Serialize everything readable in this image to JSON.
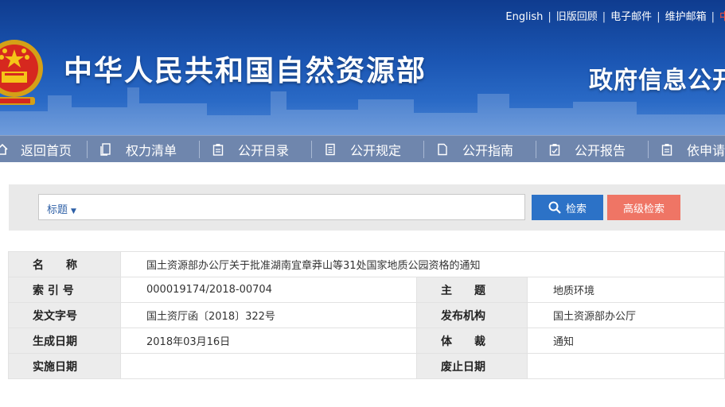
{
  "header": {
    "top_links": [
      "English",
      "旧版回顾",
      "电子邮件",
      "维护邮箱"
    ],
    "top_links_overflow": "中",
    "site_title": "中华人民共和国自然资源部",
    "section_title": "政府信息公开"
  },
  "nav": {
    "items": [
      {
        "label": "返回首页",
        "icon": "home-icon"
      },
      {
        "label": "权力清单",
        "icon": "list-icon"
      },
      {
        "label": "公开目录",
        "icon": "clipboard-icon"
      },
      {
        "label": "公开规定",
        "icon": "document-icon"
      },
      {
        "label": "公开指南",
        "icon": "page-icon"
      },
      {
        "label": "公开报告",
        "icon": "report-icon"
      },
      {
        "label": "依申请",
        "icon": "clipboard-icon"
      }
    ]
  },
  "search": {
    "scope_label": "标题",
    "input_value": "",
    "search_button": "检索",
    "advanced_button": "高级检索"
  },
  "info": {
    "name_label": "名　　称",
    "name_value": "国土资源部办公厅关于批准湖南宜章莽山等31处国家地质公园资格的通知",
    "index_label": "索 引 号",
    "index_value": "000019174/2018-00704",
    "topic_label": "主　　题",
    "topic_value": "地质环境",
    "docno_label": "发文字号",
    "docno_value": "国土资厅函〔2018〕322号",
    "issuer_label": "发布机构",
    "issuer_value": "国土资源部办公厅",
    "created_label": "生成日期",
    "created_value": "2018年03月16日",
    "genre_label": "体　　裁",
    "genre_value": "通知",
    "effective_label": "实施日期",
    "effective_value": "",
    "abolish_label": "废止日期",
    "abolish_value": ""
  },
  "colors": {
    "banner_top": "#0f3c8f",
    "nav_bg": "#6f86ad",
    "search_button": "#2c72c7",
    "advanced_button": "#ef7565"
  }
}
